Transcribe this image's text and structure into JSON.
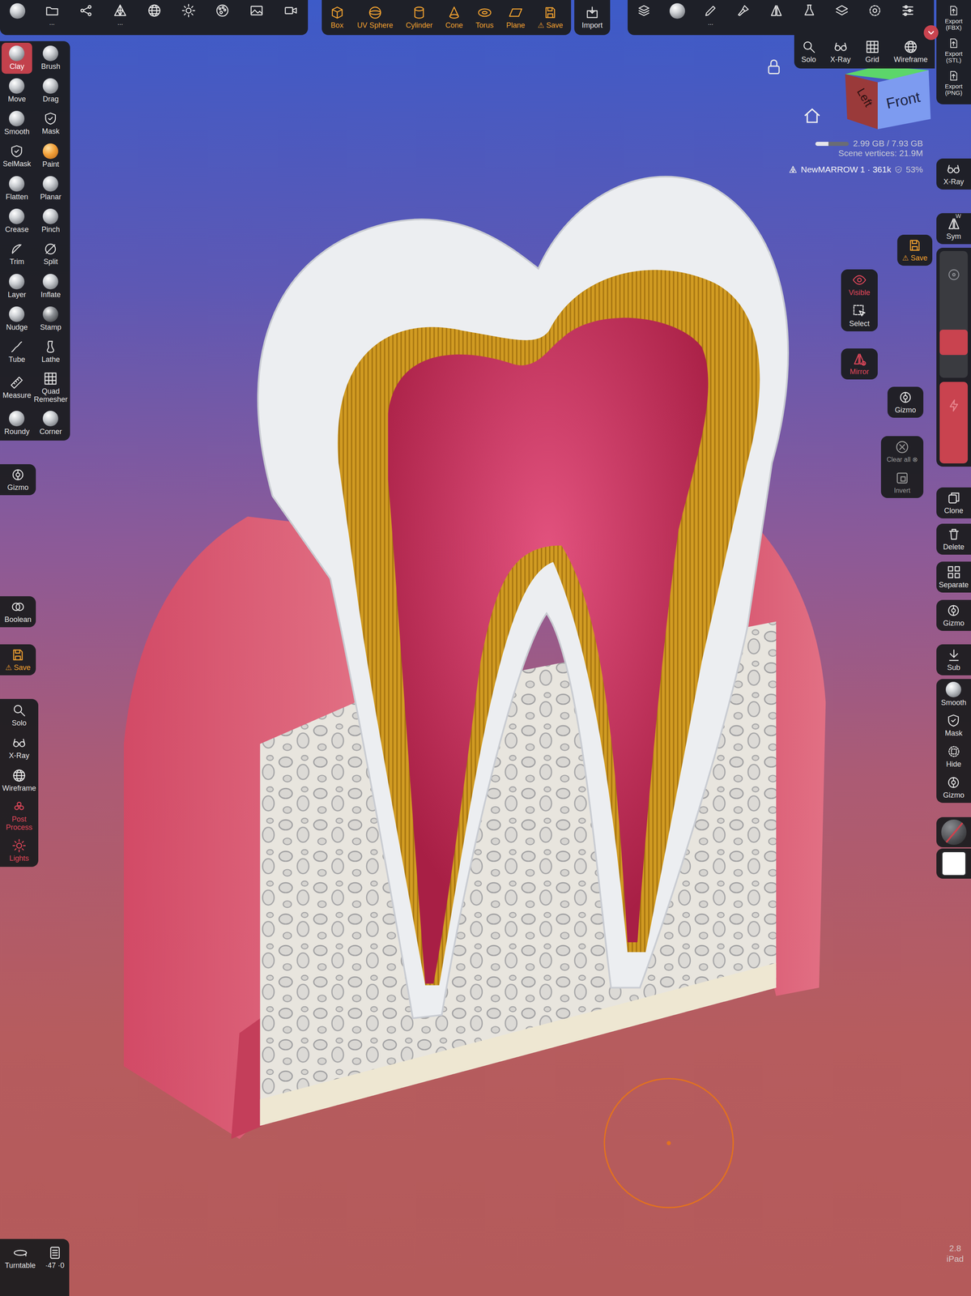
{
  "top_left_panel": {
    "file_more": "...",
    "topology_more": "..."
  },
  "primitives": [
    {
      "label": "Box"
    },
    {
      "label": "UV Sphere"
    },
    {
      "label": "Cylinder"
    },
    {
      "label": "Cone"
    },
    {
      "label": "Torus"
    },
    {
      "label": "Plane"
    }
  ],
  "primitives_save": {
    "warning": "⚠",
    "label": "Save"
  },
  "import": {
    "label": "Import"
  },
  "top_right_panel": {
    "brush_more": "..."
  },
  "export_menu": [
    {
      "label": "Export",
      "format": "(FBX)"
    },
    {
      "label": "Export",
      "format": "(STL)"
    },
    {
      "label": "Export",
      "format": "(PNG)"
    }
  ],
  "view_menu": [
    "Solo",
    "X-Ray",
    "Grid",
    "Wireframe"
  ],
  "view_cube": {
    "left": "Left",
    "front": "Front"
  },
  "stats": {
    "memory": "2.99 GB / 7.93 GB",
    "memory_level": 0.38,
    "vertices": "Scene vertices: 21.9M",
    "object": "NewMARROW 1 · 361k",
    "ratio": "53%"
  },
  "tools": [
    {
      "label": "Clay",
      "selected": true
    },
    {
      "label": "Brush",
      "selected": false
    },
    {
      "label": "Move",
      "selected": false
    },
    {
      "label": "Drag",
      "selected": false
    },
    {
      "label": "Smooth",
      "selected": false
    },
    {
      "label": "Mask",
      "selected": false
    },
    {
      "label": "SelMask",
      "selected": false
    },
    {
      "label": "Paint",
      "selected": false
    },
    {
      "label": "Flatten",
      "selected": false
    },
    {
      "label": "Planar",
      "selected": false
    },
    {
      "label": "Crease",
      "selected": false
    },
    {
      "label": "Pinch",
      "selected": false
    },
    {
      "label": "Trim",
      "selected": false
    },
    {
      "label": "Split",
      "selected": false
    },
    {
      "label": "Layer",
      "selected": false
    },
    {
      "label": "Inflate",
      "selected": false
    },
    {
      "label": "Nudge",
      "selected": false
    },
    {
      "label": "Stamp",
      "selected": false
    },
    {
      "label": "Tube",
      "selected": false
    },
    {
      "label": "Lathe",
      "selected": false
    },
    {
      "label": "Measure",
      "selected": false
    },
    {
      "label": "Quad Remesher",
      "selected": false
    },
    {
      "label": "Roundy",
      "selected": false
    },
    {
      "label": "Corner",
      "selected": false
    }
  ],
  "left_gizmo": "Gizmo",
  "boolean": "Boolean",
  "left_save": {
    "warning": "⚠",
    "label": "Save"
  },
  "display_panel": [
    {
      "label": "Solo",
      "active": false
    },
    {
      "label": "X-Ray",
      "active": false
    },
    {
      "label": "Wireframe",
      "active": false
    },
    {
      "label": "Post Process",
      "active": true
    },
    {
      "label": "Lights",
      "active": true
    }
  ],
  "turntable": {
    "label": "Turntable",
    "count": "·47",
    "extra": "·0"
  },
  "right_column": {
    "xray": "X-Ray",
    "sym": {
      "label": "Sym",
      "key": "W"
    },
    "radius_level": 0.28,
    "intensity_level": 1.0,
    "actions": [
      "Clone",
      "Delete",
      "Separate",
      "Gizmo",
      "Sub"
    ],
    "quick": [
      "Smooth",
      "Mask",
      "Hide",
      "Gizmo"
    ],
    "color": "#ffffff"
  },
  "floating": {
    "save": {
      "warning": "⚠",
      "label": "Save"
    },
    "visibility": [
      {
        "label": "Visible",
        "active": true
      },
      {
        "label": "Select",
        "active": false
      }
    ],
    "mirror": {
      "label": "Mirror",
      "active": true
    },
    "gizmo": "Gizmo",
    "clear_all": "Clear all ⊗",
    "invert": "Invert"
  },
  "version": {
    "number": "2.8",
    "device": "iPad"
  }
}
